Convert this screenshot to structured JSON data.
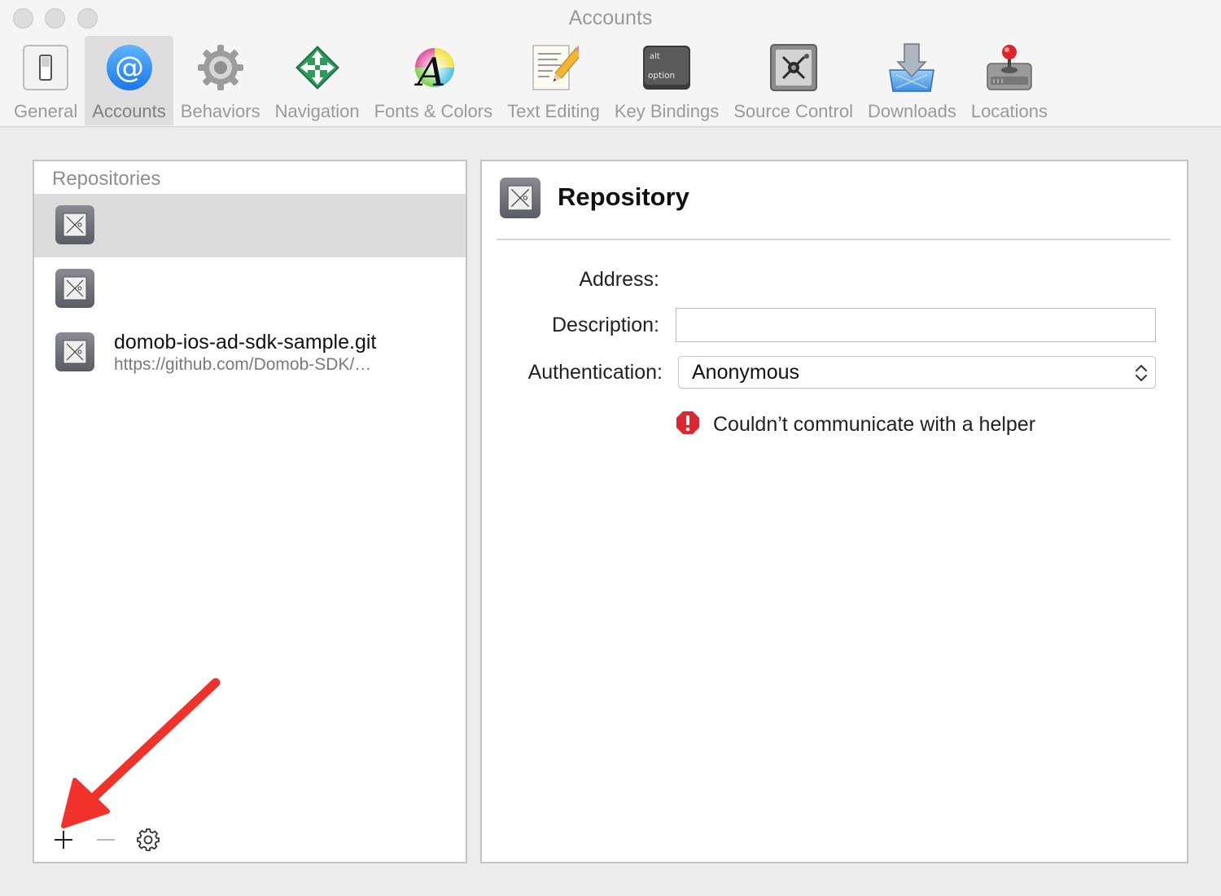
{
  "window": {
    "title": "Accounts"
  },
  "toolbar": {
    "items": [
      {
        "label": "General",
        "icon": "general-switch-icon"
      },
      {
        "label": "Accounts",
        "icon": "at-sign-icon"
      },
      {
        "label": "Behaviors",
        "icon": "gear-icon"
      },
      {
        "label": "Navigation",
        "icon": "navigation-arrows-icon"
      },
      {
        "label": "Fonts & Colors",
        "icon": "font-color-icon"
      },
      {
        "label": "Text Editing",
        "icon": "text-edit-pencil-icon"
      },
      {
        "label": "Key Bindings",
        "icon": "option-key-icon"
      },
      {
        "label": "Source Control",
        "icon": "vault-icon"
      },
      {
        "label": "Downloads",
        "icon": "download-arrow-icon"
      },
      {
        "label": "Locations",
        "icon": "joystick-drive-icon"
      }
    ],
    "selected": "Accounts",
    "option_key_top": "alt",
    "option_key_bottom": "option"
  },
  "repositories": {
    "header": "Repositories",
    "items": [
      {
        "name": "",
        "url": "",
        "selected": true
      },
      {
        "name": "",
        "url": "",
        "selected": false
      },
      {
        "name": "domob-ios-ad-sdk-sample.git",
        "url": "https://github.com/Domob-SDK/…",
        "selected": false
      }
    ]
  },
  "bottom_bar": {
    "add": "+",
    "remove": "−"
  },
  "detail": {
    "title": "Repository",
    "address_label": "Address:",
    "address_value": "",
    "description_label": "Description:",
    "description_value": "",
    "authentication_label": "Authentication:",
    "authentication_value": "Anonymous",
    "error_message": "Couldn’t communicate with a helper"
  },
  "colors": {
    "accounts_blue": "#2f8ef2",
    "error_red": "#d9282f",
    "annotation_red": "#f0322a"
  }
}
